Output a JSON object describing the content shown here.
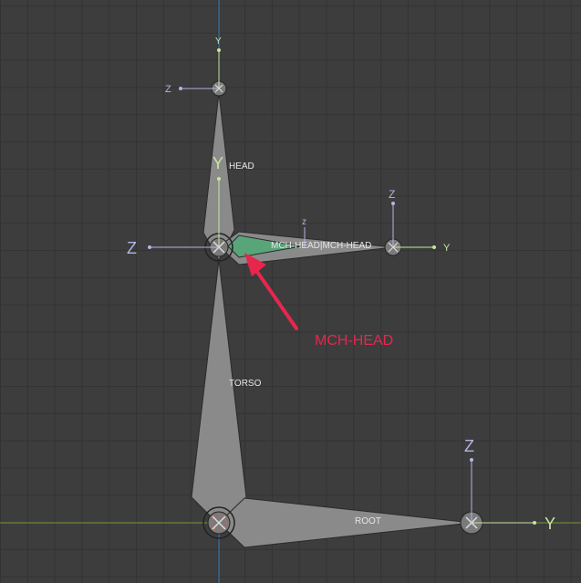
{
  "viewport": {
    "bones": [
      {
        "name": "HEAD"
      },
      {
        "name": "MCH-HEAD|MCH-HEAD"
      },
      {
        "name": "TORSO"
      },
      {
        "name": "ROOT"
      }
    ],
    "axis_labels": {
      "y": "Y",
      "z": "Z",
      "small_z": "z"
    },
    "annotation": {
      "text": "MCH-HEAD",
      "color": "#e8264d"
    },
    "colors": {
      "grid_bg": "#3d3d3d",
      "grid_line": "#333333",
      "y_axis_line": "#3b7fbd",
      "x_axis_line": "#7a9a3a",
      "bone_fill": "#8a8a8a",
      "bone_selected": "#59a57a",
      "axis_y_label": "#c8e6a0",
      "axis_z_label": "#b4b4e6"
    }
  }
}
